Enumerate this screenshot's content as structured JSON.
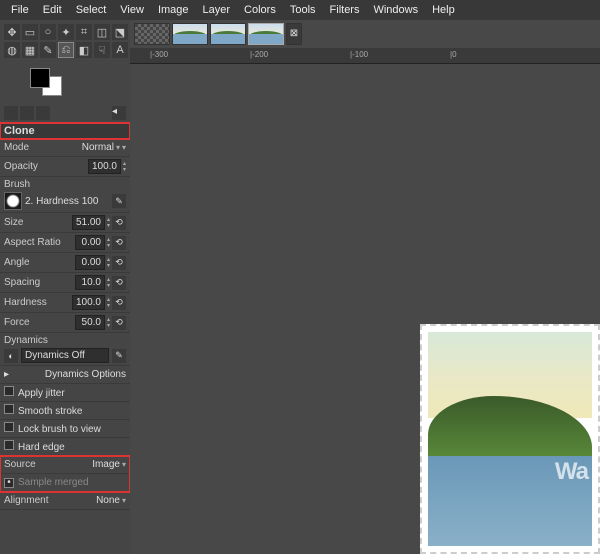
{
  "menu": [
    "File",
    "Edit",
    "Select",
    "View",
    "Image",
    "Layer",
    "Colors",
    "Tools",
    "Filters",
    "Windows",
    "Help"
  ],
  "tool_title": "Clone",
  "mode": {
    "label": "Mode",
    "value": "Normal"
  },
  "opacity": {
    "label": "Opacity",
    "value": "100.0"
  },
  "brush": {
    "label": "Brush",
    "name": "2. Hardness 100"
  },
  "size": {
    "label": "Size",
    "value": "51.00"
  },
  "aspect": {
    "label": "Aspect Ratio",
    "value": "0.00"
  },
  "angle": {
    "label": "Angle",
    "value": "0.00"
  },
  "spacing": {
    "label": "Spacing",
    "value": "10.0"
  },
  "hardness": {
    "label": "Hardness",
    "value": "100.0"
  },
  "force": {
    "label": "Force",
    "value": "50.0"
  },
  "dynamics": {
    "label": "Dynamics",
    "value": "Dynamics Off"
  },
  "dyn_opts": "Dynamics Options",
  "jitter": "Apply jitter",
  "smooth": "Smooth stroke",
  "lock": "Lock brush to view",
  "hard": "Hard edge",
  "source": {
    "label": "Source",
    "value": "Image"
  },
  "sample": "Sample merged",
  "align": {
    "label": "Alignment",
    "value": "None"
  },
  "ruler": [
    "|-300",
    "|-200",
    "|-100",
    "|0"
  ],
  "watermark": "Wa"
}
